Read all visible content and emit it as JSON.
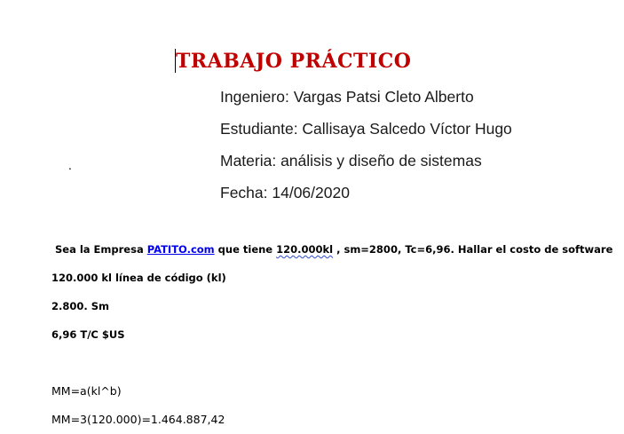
{
  "document": {
    "title": "TRABAJO PRÁCTICO",
    "info": {
      "ingeniero": "Ingeniero: Vargas Patsi Cleto Alberto",
      "estudiante": "Estudiante: Callisaya Salcedo Víctor Hugo",
      "materia": "Materia: análisis y diseño de sistemas",
      "fecha": "Fecha: 14/06/2020"
    },
    "stray_dot": ".",
    "problem": {
      "prefix": "Sea la Empresa ",
      "company_link": "PATITO.com",
      "middle": " que tiene ",
      "kl_value": "120.000kl",
      "rest": " , sm=2800, Tc=6,96. Hallar el costo de software"
    },
    "data_lines": [
      "120.000 kl línea de código (kl)",
      "2.800. Sm",
      "6,96 T/C $US"
    ],
    "formulas": [
      "MM=a(kl^b)",
      "MM=3(120.000)=1.464.887,42"
    ],
    "colors": {
      "title": "#c00000",
      "link": "#0000ee",
      "spellcheck_underline": "#2b4bd1"
    }
  }
}
